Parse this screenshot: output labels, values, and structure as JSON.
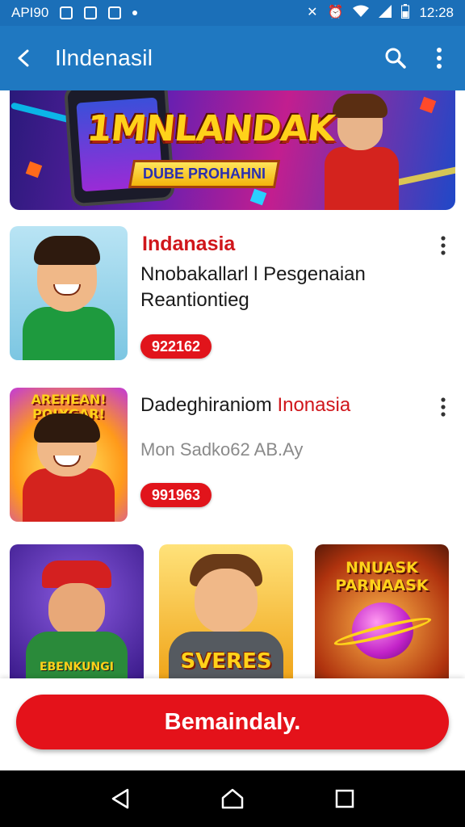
{
  "status_bar": {
    "carrier": "API90",
    "time": "12:28"
  },
  "app_bar": {
    "title": "Ilndenasil",
    "back_icon": "arrow-left-icon",
    "search_icon": "search-icon",
    "menu_icon": "more-vert-icon"
  },
  "banner": {
    "headline": "1MNLANDAK",
    "ribbon": "DUBE PROHAHNI"
  },
  "items": [
    {
      "category": "Indanasia",
      "title_parts": [
        "Nnobakallarl l Pesgenaian Reantiontieg",
        ""
      ],
      "subtitle": "",
      "badge": "922162",
      "shirt_color": "#1e9a3e",
      "bg": "#bfe6f2"
    },
    {
      "category": "",
      "title_parts": [
        "Dadeghiraniom ",
        "Inonasia"
      ],
      "subtitle": "Mon Sadko62 AB.Ay",
      "badge": "991963",
      "shirt_color": "#d4231e",
      "bg": "#ffcc33",
      "thumb_text": "AREHEAN! POLYGAR!"
    }
  ],
  "grid": [
    {
      "label": "EBENKUNGI",
      "bg": "#4a2aa0"
    },
    {
      "label": "SVERES",
      "bg": "#f2b21a"
    },
    {
      "label": "NNUASK PARNAASK",
      "bg": "#b0330e"
    }
  ],
  "cta": {
    "label": "Bemaindaly."
  },
  "colors": {
    "app_bar": "#1f78c1",
    "accent": "#e1141b"
  }
}
